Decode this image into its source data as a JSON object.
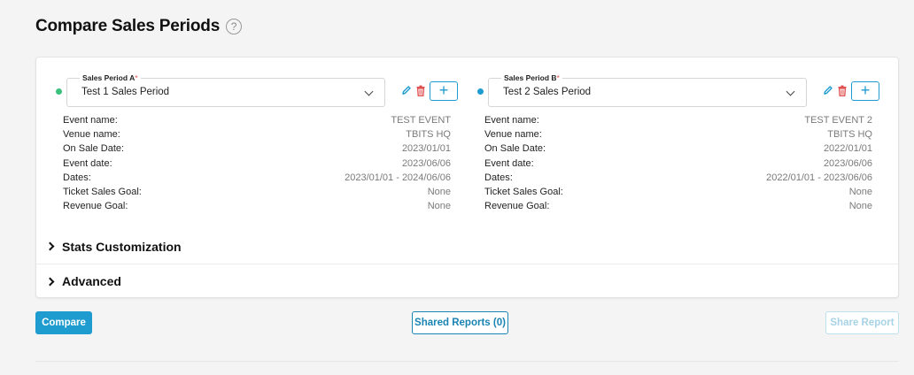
{
  "page": {
    "title": "Compare Sales Periods",
    "help_symbol": "?"
  },
  "periods": [
    {
      "label": "Sales Period A",
      "required_mark": "*",
      "selected": "Test 1 Sales Period",
      "dot_color": "#3bc17e",
      "add_symbol": "+",
      "details": [
        {
          "label": "Event name:",
          "value": "TEST EVENT"
        },
        {
          "label": "Venue name:",
          "value": "TBITS HQ"
        },
        {
          "label": "On Sale Date:",
          "value": "2023/01/01"
        },
        {
          "label": "Event date:",
          "value": "2023/06/06"
        },
        {
          "label": "Dates:",
          "value": "2023/01/01 - 2024/06/06"
        },
        {
          "label": "Ticket Sales Goal:",
          "value": "None"
        },
        {
          "label": "Revenue Goal:",
          "value": "None"
        }
      ]
    },
    {
      "label": "Sales Period B",
      "required_mark": "*",
      "selected": "Test 2 Sales Period",
      "dot_color": "#1e9ccf",
      "add_symbol": "+",
      "details": [
        {
          "label": "Event name:",
          "value": "TEST EVENT 2"
        },
        {
          "label": "Venue name:",
          "value": "TBITS HQ"
        },
        {
          "label": "On Sale Date:",
          "value": "2022/01/01"
        },
        {
          "label": "Event date:",
          "value": "2023/06/06"
        },
        {
          "label": "Dates:",
          "value": "2022/01/01 - 2023/06/06"
        },
        {
          "label": "Ticket Sales Goal:",
          "value": "None"
        },
        {
          "label": "Revenue Goal:",
          "value": "None"
        }
      ]
    }
  ],
  "sections": [
    {
      "title": "Stats Customization"
    },
    {
      "title": "Advanced"
    }
  ],
  "actions": {
    "compare": "Compare",
    "shared_reports": "Shared Reports (0)",
    "share_report": "Share Report"
  },
  "colors": {
    "accent": "#1e9ccf",
    "delete": "#e04b4b"
  },
  "icons": {
    "edit": "pencil-icon",
    "delete": "trash-icon",
    "help": "question-circle-icon"
  }
}
